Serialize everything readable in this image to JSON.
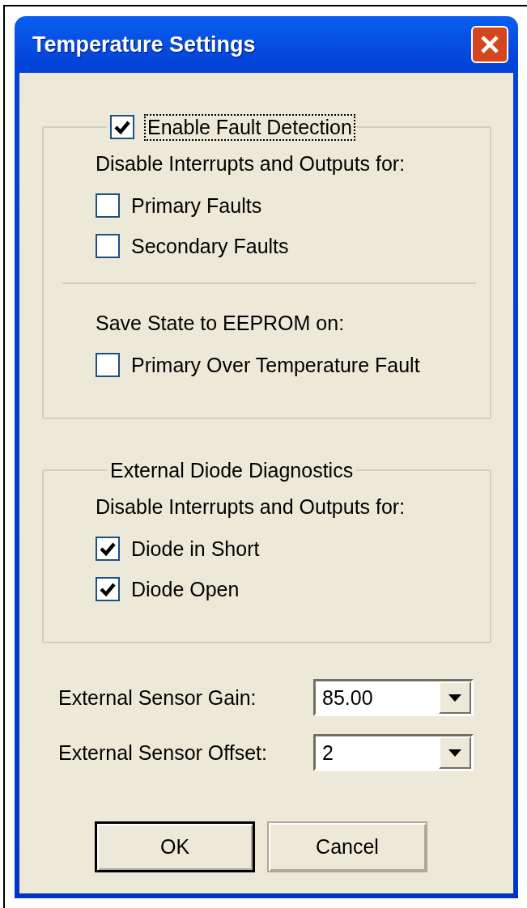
{
  "window": {
    "title": "Temperature Settings"
  },
  "groups": [
    {
      "kind": "checkbox",
      "label": "Enable Fault Detection",
      "checked": true,
      "focused": true,
      "sections": [
        {
          "heading": "Disable Interrupts and Outputs for:",
          "options": [
            {
              "label": "Primary Faults",
              "checked": false
            },
            {
              "label": "Secondary Faults",
              "checked": false
            }
          ]
        },
        {
          "heading": "Save State to EEPROM on:",
          "options": [
            {
              "label": "Primary Over Temperature Fault",
              "checked": false
            }
          ]
        }
      ]
    },
    {
      "kind": "plain",
      "label": "External Diode Diagnostics",
      "sections": [
        {
          "heading": "Disable Interrupts and Outputs for:",
          "options": [
            {
              "label": "Diode in Short",
              "checked": true
            },
            {
              "label": "Diode Open",
              "checked": true
            }
          ]
        }
      ]
    }
  ],
  "fields": [
    {
      "label": "External Sensor Gain:",
      "value": "85.00"
    },
    {
      "label": "External Sensor Offset:",
      "value": "2"
    }
  ],
  "buttons": [
    {
      "label": "OK",
      "default": true
    },
    {
      "label": "Cancel",
      "default": false
    }
  ]
}
